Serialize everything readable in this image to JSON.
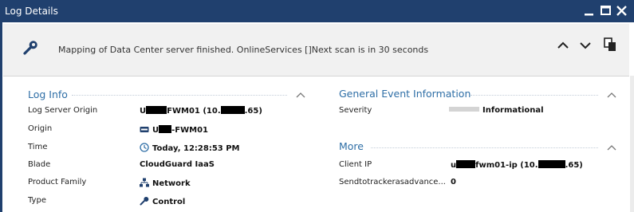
{
  "window": {
    "title": "Log Details"
  },
  "banner": {
    "message": "Mapping of Data Center server finished. OnlineServices []Next scan is in 30 seconds"
  },
  "log_info": {
    "title": "Log Info",
    "rows": [
      {
        "label": "Log Server Origin",
        "parts": [
          "U",
          "FWM01 (10.",
          ".65)"
        ]
      },
      {
        "label": "Origin",
        "parts": [
          "U",
          "-FWM01"
        ]
      },
      {
        "label": "Time",
        "value": "Today, 12:28:53 PM"
      },
      {
        "label": "Blade",
        "value": "CloudGuard IaaS"
      },
      {
        "label": "Product Family",
        "value": "Network"
      },
      {
        "label": "Type",
        "value": "Control"
      }
    ]
  },
  "general": {
    "title": "General Event Information",
    "severity_label": "Severity",
    "severity_value": "Informational"
  },
  "more": {
    "title": "More",
    "rows": [
      {
        "label": "Client IP",
        "parts": [
          "u",
          "fwm01-ip (10.",
          ".65)"
        ]
      },
      {
        "label": "Sendtotrackerasadvance...",
        "value": "0"
      }
    ]
  },
  "colors": {
    "titlebar": "#20406e",
    "section_title": "#2e6ea6",
    "banner_bg": "#f1f1f1"
  }
}
